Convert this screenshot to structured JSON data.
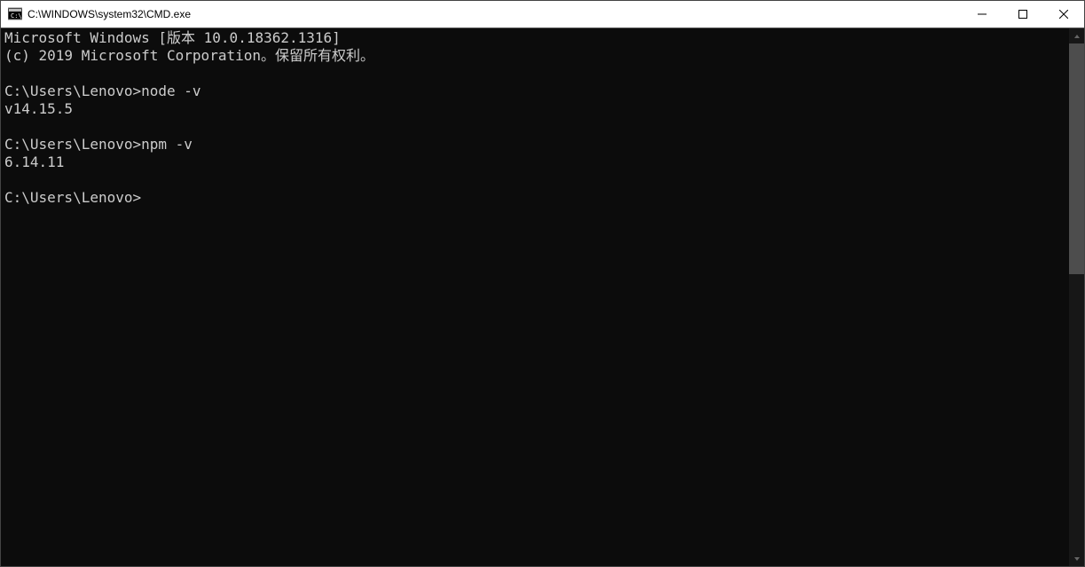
{
  "window": {
    "title": "C:\\WINDOWS\\system32\\CMD.exe"
  },
  "terminal": {
    "lines": [
      "Microsoft Windows [版本 10.0.18362.1316]",
      "(c) 2019 Microsoft Corporation。保留所有权利。",
      "",
      "C:\\Users\\Lenovo>node -v",
      "v14.15.5",
      "",
      "C:\\Users\\Lenovo>npm -v",
      "6.14.11",
      "",
      "C:\\Users\\Lenovo>"
    ]
  }
}
